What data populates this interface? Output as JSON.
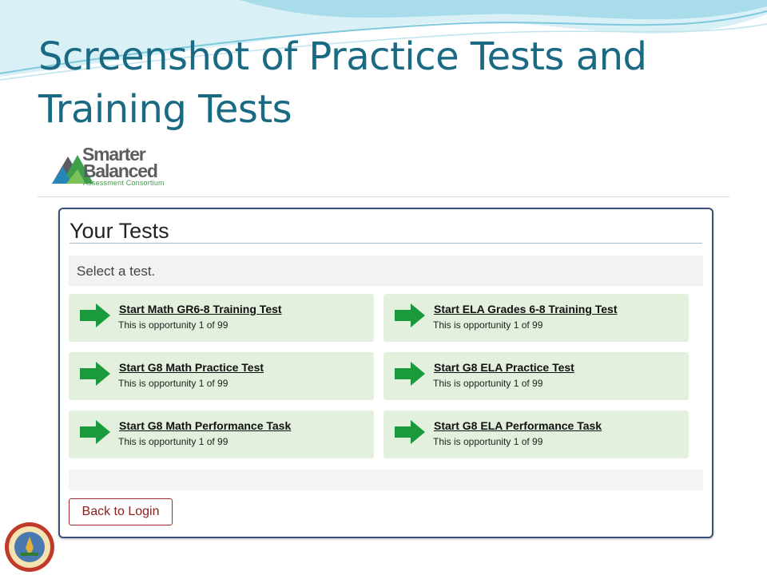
{
  "slide": {
    "title": "Screenshot of Practice Tests and Training Tests"
  },
  "brand": {
    "logo_line1": "Smarter",
    "logo_line2": "Balanced",
    "logo_line3": "Assessment Consortium"
  },
  "panel": {
    "heading": "Your Tests",
    "instruction": "Select a test."
  },
  "tests": [
    {
      "name": "Start Math GR6-8 Training Test",
      "opportunity": "This is opportunity 1 of 99"
    },
    {
      "name": "Start ELA Grades 6-8 Training Test",
      "opportunity": "This is opportunity 1 of 99"
    },
    {
      "name": "Start G8 Math Practice Test",
      "opportunity": "This is opportunity 1 of 99"
    },
    {
      "name": "Start G8 ELA Practice Test",
      "opportunity": "This is opportunity 1 of 99"
    },
    {
      "name": "Start G8 Math Performance Task",
      "opportunity": "This is opportunity 1 of 99"
    },
    {
      "name": "Start G8 ELA Performance Task",
      "opportunity": "This is opportunity 1 of 99"
    }
  ],
  "actions": {
    "back_label": "Back to Login"
  },
  "icons": {
    "test_card": "arrow-right-icon",
    "logo": "triangle-logo-icon",
    "seal": "state-seal-icon"
  },
  "colors": {
    "title": "#1a6a84",
    "card_bg": "#e2f0dd",
    "arrow": "#1a9a3c",
    "panel_border": "#3a4f77",
    "back_button": "#8b2020"
  }
}
